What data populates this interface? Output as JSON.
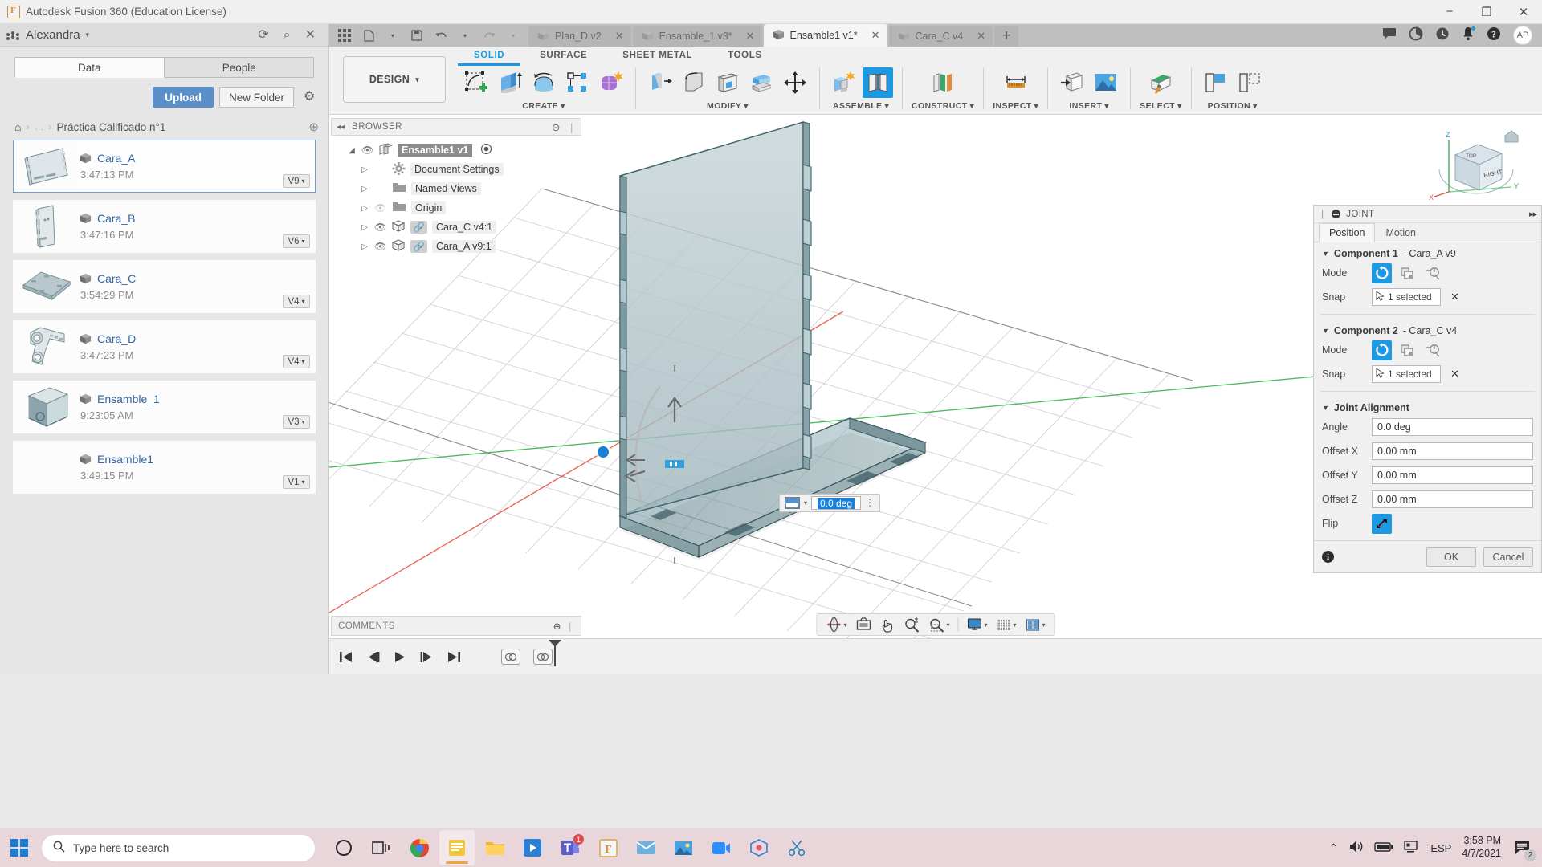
{
  "window": {
    "title": "Autodesk Fusion 360 (Education License)",
    "minimize": "−",
    "maximize": "❐",
    "close": "✕"
  },
  "data_panel": {
    "user": "Alexandra",
    "user_caret": "▾",
    "refresh_icon": "⟳",
    "search_icon": "⌕",
    "close_icon": "✕",
    "tabs": [
      {
        "label": "Data",
        "active": true
      },
      {
        "label": "People",
        "active": false
      }
    ],
    "upload_label": "Upload",
    "new_folder_label": "New Folder",
    "settings_icon": "⚙",
    "breadcrumb": {
      "home_icon": "⌂",
      "sep": "›",
      "ellipsis": "…",
      "current": "Práctica Calificado n°1",
      "globe_icon": "⊕"
    },
    "items": [
      {
        "name": "Cara_A",
        "time": "3:47:13 PM",
        "version": "V9",
        "selected": true,
        "thumb": "plate-flat"
      },
      {
        "name": "Cara_B",
        "time": "3:47:16 PM",
        "version": "V6",
        "selected": false,
        "thumb": "plate-tall"
      },
      {
        "name": "Cara_C",
        "time": "3:54:29 PM",
        "version": "V4",
        "selected": false,
        "thumb": "plate-horizontal"
      },
      {
        "name": "Cara_D",
        "time": "3:47:23 PM",
        "version": "V4",
        "selected": false,
        "thumb": "bracket"
      },
      {
        "name": "Ensamble_1",
        "time": "9:23:05 AM",
        "version": "V3",
        "selected": false,
        "thumb": "box"
      },
      {
        "name": "Ensamble1",
        "time": "3:49:15 PM",
        "version": "V1",
        "selected": false,
        "thumb": "empty"
      }
    ]
  },
  "tabstrip": {
    "quick_icons": [
      "grid-apps-icon",
      "new-file-icon",
      "save-icon",
      "undo-icon",
      "redo-icon"
    ],
    "documents": [
      {
        "label": "Plan_D v2",
        "active": false,
        "close": "✕"
      },
      {
        "label": "Ensamble_1 v3*",
        "active": false,
        "close": "✕"
      },
      {
        "label": "Ensamble1 v1*",
        "active": true,
        "close": "✕"
      },
      {
        "label": "Cara_C v4",
        "active": false,
        "close": "✕"
      }
    ],
    "add_tab": "+",
    "right_icons": [
      "comment-icon",
      "job-status-icon",
      "recent-icon",
      "notification-icon",
      "help-icon"
    ],
    "avatar": "AP"
  },
  "ribbon": {
    "design_label": "DESIGN",
    "design_caret": "▾",
    "workspace_tabs": [
      {
        "label": "SOLID",
        "active": true
      },
      {
        "label": "SURFACE",
        "active": false
      },
      {
        "label": "SHEET METAL",
        "active": false
      },
      {
        "label": "TOOLS",
        "active": false
      }
    ],
    "groups": [
      {
        "label": "CREATE",
        "caret": "▾",
        "icons": [
          "sketch-create-icon",
          "extrude-icon",
          "revolve-icon",
          "pattern-icon",
          "form-icon"
        ]
      },
      {
        "label": "MODIFY",
        "caret": "▾",
        "icons": [
          "press-pull-icon",
          "fillet-icon",
          "shell-icon",
          "offset-face-icon",
          "move-copy-icon"
        ]
      },
      {
        "label": "ASSEMBLE",
        "caret": "▾",
        "icons": [
          "new-component-icon",
          "joint-icon"
        ]
      },
      {
        "label": "CONSTRUCT",
        "caret": "▾",
        "icons": [
          "offset-plane-icon"
        ]
      },
      {
        "label": "INSPECT",
        "caret": "▾",
        "icons": [
          "measure-icon"
        ]
      },
      {
        "label": "INSERT",
        "caret": "▾",
        "icons": [
          "insert-derive-icon",
          "canvas-icon"
        ]
      },
      {
        "label": "SELECT",
        "caret": "▾",
        "icons": [
          "select-icon"
        ]
      },
      {
        "label": "POSITION",
        "caret": "▾",
        "icons": [
          "align-icon",
          "position-icon"
        ]
      }
    ],
    "joint_active": true
  },
  "browser": {
    "collapse_icon": "◂◂",
    "title": "BROWSER",
    "minus_icon": "⊖",
    "grip": "❘",
    "root": {
      "label": "Ensamble1 v1",
      "expanded": true
    },
    "nodes": [
      {
        "label": "Document Settings",
        "icon": "gear-icon",
        "triangle": "▷",
        "eye": false
      },
      {
        "label": "Named Views",
        "icon": "folder-icon",
        "triangle": "▷",
        "eye": false
      },
      {
        "label": "Origin",
        "icon": "folder-icon",
        "triangle": "▷",
        "eye": "hidden"
      },
      {
        "label": "Cara_C v4:1",
        "icon": "body-icon",
        "triangle": "▷",
        "eye": true,
        "link": true
      },
      {
        "label": "Cara_A v9:1",
        "icon": "body-icon",
        "triangle": "▷",
        "eye": true,
        "link": true
      }
    ]
  },
  "viewcube": {
    "axis_z": "Z",
    "axis_x": "X",
    "axis_y": "Y",
    "face_front": "RIGHT",
    "face_top": "TOP"
  },
  "angle_widget": {
    "value": "0.0 deg",
    "caret": "▾",
    "menu": "⋮"
  },
  "comments": {
    "title": "COMMENTS",
    "add_icon": "⊕",
    "grip": "❘"
  },
  "joint_dialog": {
    "title": "JOINT",
    "expand_icon": "▸▸",
    "grip": "❘",
    "tabs": [
      {
        "label": "Position",
        "active": true
      },
      {
        "label": "Motion",
        "active": false
      }
    ],
    "component1": {
      "title_prefix": "Component 1",
      "title_value": " - Cara_A v9",
      "mode_label": "Mode",
      "snap_label": "Snap",
      "snap_value": "1 selected",
      "clear_icon": "✕",
      "modes": [
        "simple-icon",
        "between-two-faces-icon",
        "two-edge-intersection-icon"
      ],
      "mode_active_index": 0
    },
    "component2": {
      "title_prefix": "Component 2",
      "title_value": " - Cara_C v4",
      "mode_label": "Mode",
      "snap_label": "Snap",
      "snap_value": "1 selected",
      "clear_icon": "✕",
      "modes": [
        "simple-icon",
        "between-two-faces-icon",
        "two-edge-intersection-icon"
      ],
      "mode_active_index": 0
    },
    "alignment": {
      "title": "Joint Alignment",
      "triangle": "▼",
      "fields": [
        {
          "label": "Angle",
          "value": "0.0 deg"
        },
        {
          "label": "Offset X",
          "value": "0.00 mm"
        },
        {
          "label": "Offset Y",
          "value": "0.00 mm"
        },
        {
          "label": "Offset Z",
          "value": "0.00 mm"
        }
      ],
      "flip_label": "Flip"
    },
    "ok_label": "OK",
    "cancel_label": "Cancel",
    "info_icon": "i"
  },
  "viewport_tools": {
    "items": [
      {
        "name": "orbit-icon",
        "caret": true
      },
      {
        "name": "look-at-icon",
        "caret": false
      },
      {
        "name": "pan-icon",
        "caret": false
      },
      {
        "name": "zoom-icon",
        "caret": false
      },
      {
        "name": "fit-icon",
        "caret": true
      },
      {
        "name": "display-settings-icon",
        "caret": true
      },
      {
        "name": "grid-snaps-icon",
        "caret": true
      },
      {
        "name": "viewports-icon",
        "caret": true
      }
    ]
  },
  "timeline": {
    "buttons": [
      "go-to-beginning-icon",
      "step-back-icon",
      "play-icon",
      "step-forward-icon",
      "go-to-end-icon"
    ],
    "features": [
      "joint-feature-icon",
      "joint-feature-icon"
    ]
  },
  "taskbar": {
    "search_placeholder": "Type here to search",
    "search_icon": "⌕",
    "apps": [
      "cortana-icon",
      "task-view-icon",
      "chrome-icon",
      "sticky-notes-icon",
      "file-explorer-icon",
      "media-player-icon",
      "teams-icon",
      "fusion360-icon",
      "mail-icon",
      "photos-icon",
      "zoom-icon",
      "3d-app-icon",
      "scissors-icon"
    ],
    "tray": {
      "chevron": "⌃",
      "volume_icon": "🔊",
      "battery_icon": "▭",
      "network_icon": "🖥",
      "language": "ESP",
      "time": "3:58 PM",
      "date": "4/7/2021",
      "notification_count": "2"
    }
  },
  "colors": {
    "accent_blue": "#1b9ae3",
    "upload_blue": "#5b8fc9",
    "link_blue": "#3464a0",
    "taskbar": "#e8d6da",
    "panel_bg": "#f0f0f0"
  }
}
